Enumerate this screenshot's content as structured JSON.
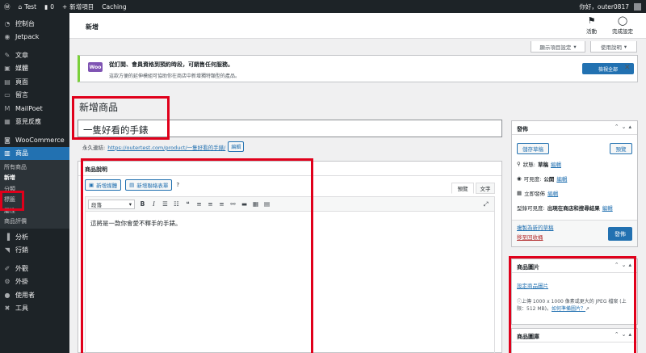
{
  "adminbar": {
    "wp_logo": "wordpress-icon",
    "site_name": "Test",
    "comments_count": "0",
    "new_label": "新增項目",
    "caching_label": "Caching",
    "greeting": "你好，outer0817"
  },
  "sidebar": {
    "items": [
      {
        "icon": "◔",
        "label": "控制台"
      },
      {
        "icon": "◉",
        "label": "Jetpack"
      },
      {
        "icon": "✎",
        "label": "文章"
      },
      {
        "icon": "▣",
        "label": "媒體"
      },
      {
        "icon": "▤",
        "label": "頁面"
      },
      {
        "icon": "▭",
        "label": "留言"
      },
      {
        "icon": "M",
        "label": "MailPoet"
      },
      {
        "icon": "▦",
        "label": "意見反應"
      },
      {
        "icon": "◙",
        "label": "WooCommerce"
      },
      {
        "icon": "▥",
        "label": "商品"
      }
    ],
    "product_submenu": [
      "所有商品",
      "新增",
      "分類",
      "標籤",
      "屬性",
      "商品評價"
    ],
    "items_after": [
      {
        "icon": "▐",
        "label": "分析"
      },
      {
        "icon": "◥",
        "label": "行銷"
      },
      {
        "icon": "✐",
        "label": "外觀"
      },
      {
        "icon": "⚙",
        "label": "外掛"
      },
      {
        "icon": "●",
        "label": "使用者"
      },
      {
        "icon": "✖",
        "label": "工具"
      }
    ]
  },
  "topbar": {
    "title": "新增",
    "activity_label": "活動",
    "complete_label": "完成設定"
  },
  "screen_tabs": {
    "screen_options": "顯示項目設定",
    "help": "使用說明"
  },
  "notice": {
    "logo": "Woo",
    "line1": "從訂閱、會員資格到預約時段，可銷售任何服務。",
    "line2": "這款方便的延伸模組可協助你在商店中新增獨特類型的產品。",
    "button": "檢視全部"
  },
  "editor": {
    "page_title": "新增商品",
    "product_title": "一隻好看的手錶",
    "permalink_label": "永久連結:",
    "permalink_url": "https://outertest.com/product/一隻好看的手錶/",
    "permalink_edit": "編輯",
    "desc_header": "商品說明",
    "add_media": "新增媒體",
    "add_form": "新增聯絡表單",
    "tab_visual": "預覽",
    "tab_text": "文字",
    "format_select": "段落",
    "content": "這將是一款你會愛不釋手的手錶。"
  },
  "publish": {
    "header": "發佈",
    "save_draft": "儲存草稿",
    "preview": "預覽",
    "status_label": "狀態:",
    "status_value": "草稿",
    "status_edit": "編輯",
    "visibility_label": "可見度:",
    "visibility_value": "公開",
    "visibility_edit": "編輯",
    "publish_time": "立即發佈",
    "publish_time_edit": "編輯",
    "catalog_label": "型錄可見度:",
    "catalog_value": "出現在商店和搜尋結果",
    "catalog_edit": "編輯",
    "copy_draft": "複製為新的草稿",
    "trash": "移至回收桶",
    "publish_button": "發佈"
  },
  "product_image": {
    "header": "商品圖片",
    "set_link": "設定商品圖片",
    "hint": "上傳 1000 x 1000 像素或更大的 JPEG 檔案 (上限：512 MB)。",
    "hint_link": "如何準備圖片？"
  },
  "gallery": {
    "header": "商品圖庫"
  },
  "colors": {
    "accent": "#2271b1",
    "highlight_border": "#e0001b",
    "sidebar_bg": "#1d2327"
  }
}
